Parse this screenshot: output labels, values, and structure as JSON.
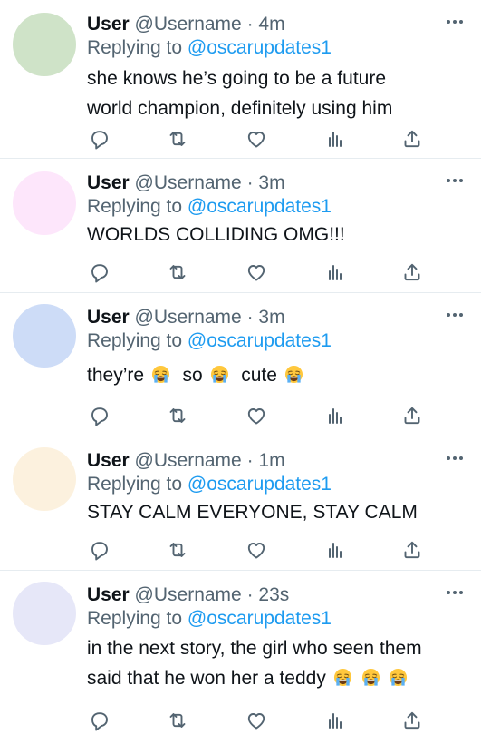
{
  "tweets": [
    {
      "user": "User",
      "handle": "@Username",
      "separator": "·",
      "time": "4m",
      "replying_prefix": "Replying to",
      "replying_to": "@oscarupdates1",
      "line1": "she knows he’s going to be a future",
      "line2": "world champion, definitely using him",
      "avatar_color": "#cfe3c8"
    },
    {
      "user": "User",
      "handle": "@Username",
      "separator": "·",
      "time": "3m",
      "replying_prefix": "Replying to",
      "replying_to": "@oscarupdates1",
      "line1": "WORLDS COLLIDING OMG!!!",
      "avatar_color": "#fde6fb"
    },
    {
      "user": "User",
      "handle": "@Username",
      "separator": "·",
      "time": "3m",
      "replying_prefix": "Replying to",
      "replying_to": "@oscarupdates1",
      "seg1": "they’re",
      "seg2": "so",
      "seg3": "cute",
      "avatar_color": "#cddcf7"
    },
    {
      "user": "User",
      "handle": "@Username",
      "separator": "·",
      "time": "1m",
      "replying_prefix": "Replying to",
      "replying_to": "@oscarupdates1",
      "line1": "STAY CALM EVERYONE, STAY CALM",
      "avatar_color": "#fcf1de"
    },
    {
      "user": "User",
      "handle": "@Username",
      "separator": "·",
      "time": "23s",
      "replying_prefix": "Replying to",
      "replying_to": "@oscarupdates1",
      "line1": "in the next story, the girl who seen them",
      "line2": "said that he won her a teddy",
      "avatar_color": "#e6e7f8"
    }
  ],
  "icons": {
    "reply": "reply-icon",
    "retweet": "retweet-icon",
    "like": "heart-icon",
    "analytics": "analytics-icon",
    "share": "share-icon",
    "more": "more-icon",
    "emoji": "loudly-crying-face-emoji"
  },
  "colors": {
    "text": "#0f1419",
    "secondary": "#536471",
    "mention": "#1d9bf0",
    "divider": "#e6ecf0"
  }
}
